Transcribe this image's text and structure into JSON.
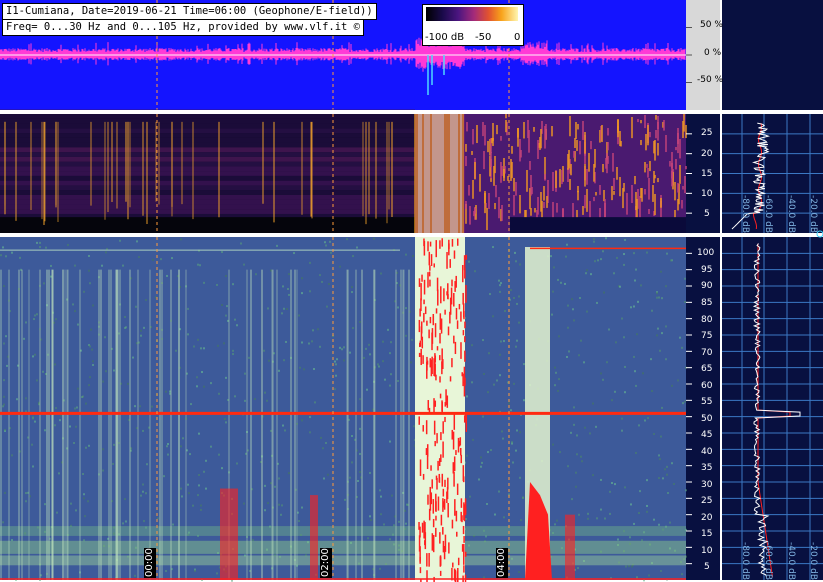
{
  "header": {
    "line1": "I1-Cumiana, Date=2019-06-21 Time=06:00 (Geophone/E-field))",
    "line2": "Freq= 0...30 Hz and 0...105 Hz, provided by www.vlf.it ©"
  },
  "colorbar": {
    "labels": [
      "-100 dB",
      "-50",
      "0"
    ]
  },
  "colors": {
    "waveform_bg": "#1414ff",
    "waveform": "#ff3ad6",
    "spectro_low_bg": "#090918",
    "spectro_hi_bg": "#3d5a9a",
    "side_bg": "#081040",
    "grid": "#3b78c4",
    "trace": "#ffffff",
    "trace_red": "#ff2020",
    "hum": "#ff2a10"
  },
  "chart_data": [
    {
      "type": "line",
      "name": "waveform",
      "ylabel_ticks": [
        "50 %",
        "0 %",
        "-50 %"
      ],
      "y_ticks": [
        50,
        0,
        -50
      ],
      "ylim": [
        -100,
        100
      ]
    },
    {
      "type": "heatmap",
      "name": "spectrogram-0-30",
      "y_ticks": [
        25,
        20,
        15,
        10,
        5
      ],
      "ylim": [
        0,
        30
      ],
      "x_time_ticks": [],
      "side_spectrum": {
        "db_ticks": [
          "-80.0 dB",
          "-60.0 dB",
          "-40.0 dB",
          "-20.0 dB"
        ]
      }
    },
    {
      "type": "heatmap",
      "name": "spectrogram-0-105",
      "y_ticks": [
        100,
        95,
        90,
        85,
        80,
        75,
        70,
        65,
        60,
        55,
        50,
        45,
        40,
        35,
        30,
        25,
        20,
        15,
        10,
        5
      ],
      "ylim": [
        0,
        105
      ],
      "x_time_ticks": [
        "00:00",
        "02:00",
        "04:00"
      ],
      "annotations": [
        "hum line at 50 Hz"
      ],
      "side_spectrum": {
        "db_ticks": [
          "-80.0 dB",
          "-60.0 dB",
          "-40.0 dB",
          "-20.0 dB"
        ]
      }
    }
  ]
}
